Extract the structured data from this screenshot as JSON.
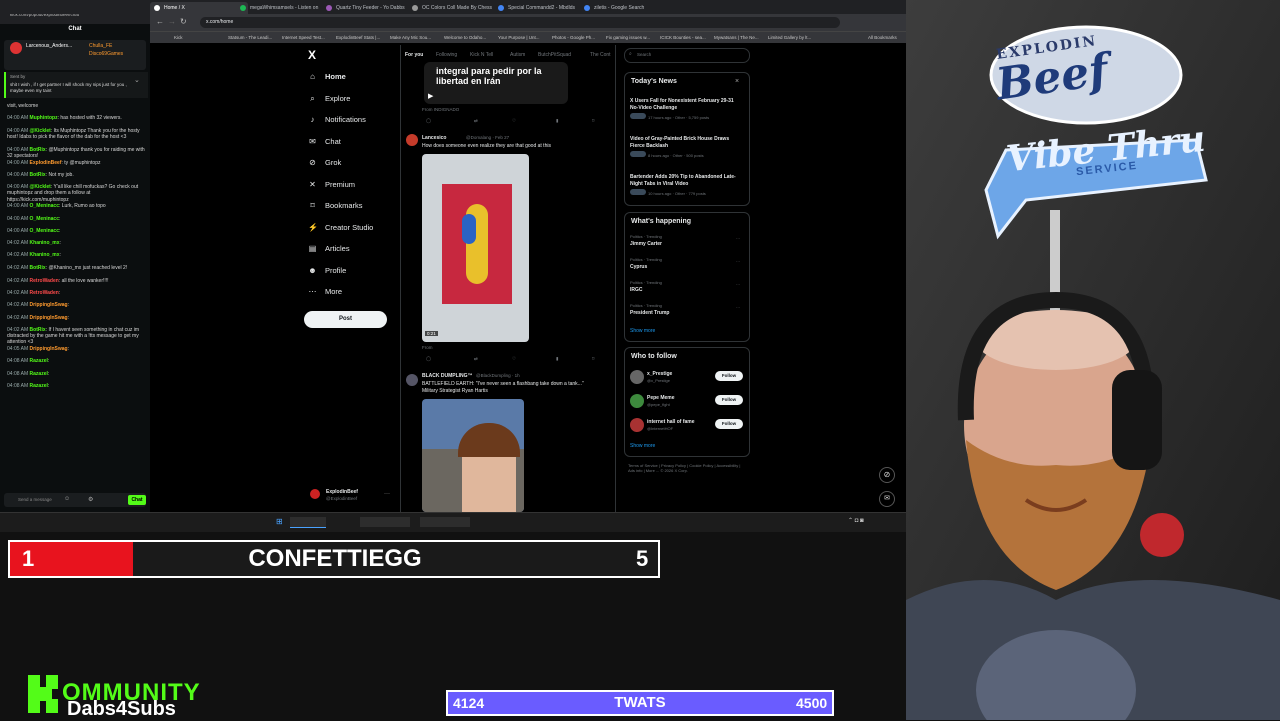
{
  "browser": {
    "tabs": [
      {
        "label": "Home / X"
      },
      {
        "label": "megaWhimsamsels - Listen on"
      },
      {
        "label": "Quartz Tiny Feeder - Yo Dabbs"
      },
      {
        "label": "OC Colors Coll Made By Chess"
      },
      {
        "label": "Special Commandd2 - Mbdlds"
      },
      {
        "label": "ziletis - Google Search"
      }
    ],
    "url": "x.com/home",
    "bookmarks": [
      "Kick",
      "Statsum - The Leadi...",
      "Internet Speed Test...",
      "ExplodinBeef Stats |...",
      "Make Any Mic Sou...",
      "Welcome to Odaho...",
      "Your Purpose | Unt...",
      "Photos - Google Ph...",
      "Fix gaming issues w...",
      "ICICK Bounties - sea...",
      "Mywatsans | The Ne...",
      "Limited Gallery by lt...",
      "All Bookmarks"
    ]
  },
  "chat_window": {
    "url": "kick.com/popout/explodinbeef/chat",
    "title": "Chat",
    "pinned_user": "Larcenous_Anders...",
    "pinned_user2": "Chulla_FE",
    "pinned_user3": "Disco69Games",
    "pinned_label": "Sent by",
    "pinned_text": "shit I wish , if I get partner I will shock my nips just for you , maybe even my taint",
    "messages": [
      {
        "time": "",
        "user": "",
        "text": "visit, welcome"
      },
      {
        "time": "04:00 AM",
        "user": "Muphintopz",
        "text": "has hosted with 32 viewers."
      },
      {
        "time": "04:00 AM",
        "user": "@Kicklet",
        "text": "Its Muphintopz Thank you for the hosty host! Idabs to pick the flavor of the dab for the host <3"
      },
      {
        "time": "04:00 AM",
        "user": "BotRix",
        "text": "@Muphintopz thank you for raiding me with 32 spectators!"
      },
      {
        "time": "04:00 AM",
        "user": "ExplodinBeef",
        "text": "ty @muphintopz"
      },
      {
        "time": "04:00 AM",
        "user": "BotRix",
        "text": "Not my job."
      },
      {
        "time": "04:00 AM",
        "user": "@Kicklet",
        "text": "Y'all like chill mofuckas? Go check out muphintopz and drop them a follow at https://kick.com/muphintopz"
      },
      {
        "time": "04:00 AM",
        "user": "O_Meninacc",
        "text": "Lurk, Rumo ao topo"
      },
      {
        "time": "04:00 AM",
        "user": "O_Meninacc",
        "text": ""
      },
      {
        "time": "04:00 AM",
        "user": "O_Meninacc",
        "text": ""
      },
      {
        "time": "04:02 AM",
        "user": "Khanino_mx",
        "text": ""
      },
      {
        "time": "04:02 AM",
        "user": "Khanino_mx",
        "text": ""
      },
      {
        "time": "04:02 AM",
        "user": "BotRix",
        "text": "@Khanino_mx just reached level 2!"
      },
      {
        "time": "04:02 AM",
        "user": "RetroWaden",
        "text": "all the love wanker!!!!"
      },
      {
        "time": "04:02 AM",
        "user": "RetroWaden",
        "text": ""
      },
      {
        "time": "04:02 AM",
        "user": "DrippingInSwag",
        "text": ""
      },
      {
        "time": "04:02 AM",
        "user": "DrippingInSwag",
        "text": ""
      },
      {
        "time": "04:02 AM",
        "user": "BotRix",
        "text": "If I havent seen something in chat cuz im distracted by the game hit me with a !tts message to get my attention <3"
      },
      {
        "time": "04:05 AM",
        "user": "DrippingInSwag",
        "text": ""
      },
      {
        "time": "04:08 AM",
        "user": "Razazel",
        "text": ""
      },
      {
        "time": "04:08 AM",
        "user": "Razazel",
        "text": ""
      },
      {
        "time": "04:08 AM",
        "user": "Razazel",
        "text": ""
      }
    ],
    "input_placeholder": "Send a message",
    "send_label": "Chat"
  },
  "x_page": {
    "logo": "X",
    "nav": [
      {
        "label": "Home",
        "icon": "home-icon"
      },
      {
        "label": "Explore",
        "icon": "search-icon"
      },
      {
        "label": "Notifications",
        "icon": "bell-icon"
      },
      {
        "label": "Chat",
        "icon": "mail-icon"
      },
      {
        "label": "Grok",
        "icon": "grok-icon"
      },
      {
        "label": "Premium",
        "icon": "x-icon"
      },
      {
        "label": "Bookmarks",
        "icon": "bookmark-icon"
      },
      {
        "label": "Creator Studio",
        "icon": "lightning-icon"
      },
      {
        "label": "Articles",
        "icon": "article-icon"
      },
      {
        "label": "Profile",
        "icon": "person-icon"
      },
      {
        "label": "More",
        "icon": "more-icon"
      }
    ],
    "post_button": "Post",
    "account_name": "ExplodinBeef",
    "account_handle": "@ExplodinBeef",
    "feed_tabs": [
      "For you",
      "Following",
      "Kick N Tell",
      "Autism",
      "ButchPitSquad",
      "The Cont"
    ],
    "posts": [
      {
        "name": "",
        "text": "integral para pedir por la libertad en Irán",
        "source": "From INDIGNADO"
      },
      {
        "name": "Lancesico",
        "handle": "@Domalang · Feb 27",
        "text": "How does someone even realize they are that good at this",
        "duration": "0:21",
        "source": "From"
      },
      {
        "name": "BLACK DUMPLING™",
        "handle": "@BlackDumpling · 1h",
        "text": "BATTLEFIELD EARTH: \"I've never seen a flashbang take down a tank...\"",
        "text2": "Military Strategist Ryan Hartis"
      }
    ],
    "search_placeholder": "Search",
    "todays_news": {
      "title": "Today's News",
      "items": [
        {
          "headline": "X Users Fall for Nonexistent February 29-31 No-Video Challenge",
          "meta": "17 hours ago · Other · 5,759 posts"
        },
        {
          "headline": "Video of Gray-Painted Brick House Draws Fierce Backlash",
          "meta": "8 hours ago · Other · 500 posts"
        },
        {
          "headline": "Bartender Adds 20% Tip to Abandoned Late-Night Tabs in Viral Video",
          "meta": "10 hours ago · Other · 779 posts"
        }
      ]
    },
    "whats_happening": {
      "title": "What's happening",
      "items": [
        {
          "category": "Politics · Trending",
          "topic": "Jimmy Carter"
        },
        {
          "category": "Politics · Trending",
          "topic": "Cyprus"
        },
        {
          "category": "Politics · Trending",
          "topic": "IRGC"
        },
        {
          "category": "Politics · Trending",
          "topic": "President Trump"
        }
      ],
      "show_more": "Show more"
    },
    "who_to_follow": {
      "title": "Who to follow",
      "items": [
        {
          "name": "x_Prestige",
          "handle": "@x_Prestige"
        },
        {
          "name": "Pepe Meme",
          "handle": "@pepe_fight"
        },
        {
          "name": "internet hall of fame",
          "handle": "@InternetHOF"
        }
      ],
      "follow_label": "Follow",
      "show_more": "Show more"
    },
    "footer": "Terms of Service | Privacy Policy | Cookie Policy | Accessibility | Ads info | More ... © 2026 X Corp."
  },
  "overlay": {
    "goal1": {
      "current": "1",
      "name": "CONFETTIEGG",
      "target": "5",
      "fill_fraction": 0.19,
      "fill_color": "#e8131e"
    },
    "goal2": {
      "current": "4124",
      "name": "TWATS",
      "target": "4500",
      "color": "#6a5cff"
    },
    "kick_text": "OMMUNITY",
    "kick_sub": "Dabs4Subs"
  },
  "webcam_sign": {
    "line1": "EXPLODIN",
    "line2": "Beef",
    "line3": "Vibe Thru",
    "line4": "SERVICE"
  }
}
